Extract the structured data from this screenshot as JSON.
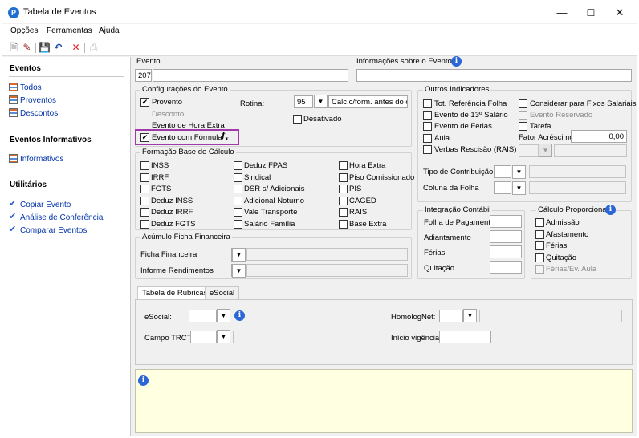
{
  "window": {
    "title": "Tabela de Eventos",
    "minimize": "—",
    "maximize": "☐",
    "close": "✕"
  },
  "menu": {
    "opcoes": "Opções",
    "ferramentas": "Ferramentas",
    "ajuda": "Ajuda"
  },
  "toolbar": {
    "icons": [
      "new-icon",
      "edit-icon",
      "save-icon",
      "undo-icon",
      "delete-icon",
      "print-icon"
    ]
  },
  "sidebar": {
    "eventos_title": "Eventos",
    "todos": "Todos",
    "proventos": "Proventos",
    "descontos": "Descontos",
    "informativos_title": "Eventos Informativos",
    "informativos": "Informativos",
    "utilitarios_title": "Utilitários",
    "copiar": "Copiar Evento",
    "analise": "Análise de Conferência",
    "comparar": "Comparar Eventos"
  },
  "evento": {
    "label": "Evento",
    "code": "207",
    "name": "",
    "info_label": "Informações sobre o Evento",
    "info_value": ""
  },
  "config": {
    "title": "Configurações do Evento",
    "provento": "Provento",
    "provento_checked": true,
    "desconto": "Desconto",
    "hora_extra": "Evento de Hora Extra",
    "formula": "Evento com Fórmula",
    "formula_checked": true,
    "fx": "fx",
    "rotina_label": "Rotina:",
    "rotina_code": "95",
    "rotina_desc": "Calc.c/form. antes do ca",
    "desativado": "Desativado"
  },
  "outros": {
    "title": "Outros Indicadores",
    "tot_ref": "Tot. Referência Folha",
    "ev13": "Evento de 13º Salário",
    "ferias": "Evento de Férias",
    "aula": "Aula",
    "verbas": "Verbas Rescisão (RAIS)",
    "considerar": "Considerar para Fixos Salariais",
    "reservado": "Evento Reservado",
    "tarefa": "Tarefa",
    "fator_label": "Fator Acréscimo",
    "fator_value": "0,00",
    "tipo_contrib": "Tipo de Contribuição",
    "coluna_folha": "Coluna da Folha"
  },
  "base": {
    "title": "Formação Base de Cálculo",
    "col1": [
      "INSS",
      "IRRF",
      "FGTS",
      "Deduz INSS",
      "Deduz IRRF",
      "Deduz FGTS"
    ],
    "col2": [
      "Deduz FPAS",
      "Sindical",
      "DSR s/ Adicionais",
      "Adicional Noturno",
      "Vale Transporte",
      "Salário Família"
    ],
    "col3": [
      "Hora Extra",
      "Piso Comissionado",
      "PIS",
      "CAGED",
      "RAIS",
      "Base Extra"
    ]
  },
  "acumulo": {
    "title": "Acúmulo Ficha Financeira",
    "ficha": "Ficha Financeira",
    "informe": "Informe Rendimentos"
  },
  "integracao": {
    "title": "Integração Contábil",
    "folha": "Folha de Pagamento",
    "adiantamento": "Adiantamento",
    "ferias": "Férias",
    "quitacao": "Quitação"
  },
  "proporcional": {
    "title": "Cálculo Proporcional",
    "items": [
      "Admissão",
      "Afastamento",
      "Férias",
      "Quitação",
      "Férias/Ev. Aula"
    ]
  },
  "tabs": {
    "rubricas": "Tabela de Rubricas",
    "esocial": "eSocial"
  },
  "esocial_panel": {
    "esocial_label": "eSocial:",
    "homolog_label": "HomologNet:",
    "trct_label": "Campo TRCT:",
    "inicio_label": "Início vigência:"
  }
}
